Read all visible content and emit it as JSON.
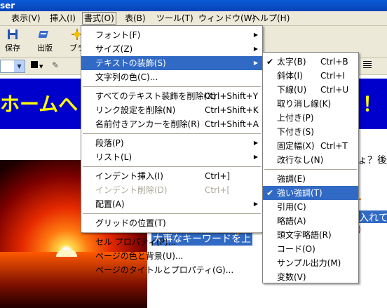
{
  "title": "ser",
  "menubar": [
    "表示(V)",
    "挿入(I)",
    "書式(O)",
    "表(B)",
    "ツール(T)",
    "ウィンドウ(W)",
    "ヘルプ(H)"
  ],
  "toolbar": {
    "save": "保存",
    "publish": "出版",
    "third": "ブラ"
  },
  "page": {
    "banner_text": "ホームへ",
    "banner_excl": "！",
    "right_text": "ょ？後い",
    "selected_text": "大事なキーワードを上",
    "selected_tail": "入れて"
  },
  "format_menu": [
    {
      "label": "フォント(F)",
      "arrow": true
    },
    {
      "label": "サイズ(Z)",
      "arrow": true
    },
    {
      "label": "テキストの装飾(S)",
      "arrow": true,
      "highlight": true
    },
    {
      "label": "文字列の色(C)..."
    },
    {
      "sep": true
    },
    {
      "label": "すべてのテキスト装飾を削除(X)",
      "shortcut": "Ctrl+Shift+Y"
    },
    {
      "label": "リンク設定を削除(N)",
      "shortcut": "Ctrl+Shift+K"
    },
    {
      "label": "名前付きアンカーを削除(R)",
      "shortcut": "Ctrl+Shift+A"
    },
    {
      "sep": true
    },
    {
      "label": "段落(P)",
      "arrow": true
    },
    {
      "label": "リスト(L)",
      "arrow": true
    },
    {
      "sep": true
    },
    {
      "label": "インデント挿入(I)",
      "shortcut": "Ctrl+]"
    },
    {
      "label": "インデント削除(D)",
      "shortcut": "Ctrl+[",
      "disabled": true
    },
    {
      "label": "配置(A)",
      "arrow": true
    },
    {
      "sep": true
    },
    {
      "label": "グリッドの位置(T)"
    },
    {
      "sep": true
    },
    {
      "label": "セル プロパティ(P)..."
    },
    {
      "label": "ページの色と背景(U)..."
    },
    {
      "label": "ページのタイトルとプロパティ(G)..."
    }
  ],
  "decoration_menu": [
    {
      "label": "太字(B)",
      "shortcut": "Ctrl+B",
      "checked": true
    },
    {
      "label": "斜体(I)",
      "shortcut": "Ctrl+I"
    },
    {
      "label": "下線(U)",
      "shortcut": "Ctrl+U"
    },
    {
      "label": "取り消し線(K)"
    },
    {
      "label": "上付き(P)"
    },
    {
      "label": "下付き(S)"
    },
    {
      "label": "固定幅(X)",
      "shortcut": "Ctrl+T"
    },
    {
      "label": "改行なし(N)"
    },
    {
      "sep": true
    },
    {
      "label": "強調(E)"
    },
    {
      "label": "強い強調(T)",
      "checked": true,
      "highlight": true
    },
    {
      "label": "引用(C)"
    },
    {
      "label": "略語(A)"
    },
    {
      "label": "頭文字略語(R)"
    },
    {
      "label": "コード(O)"
    },
    {
      "label": "サンプル出力(M)"
    },
    {
      "label": "変数(V)"
    }
  ]
}
